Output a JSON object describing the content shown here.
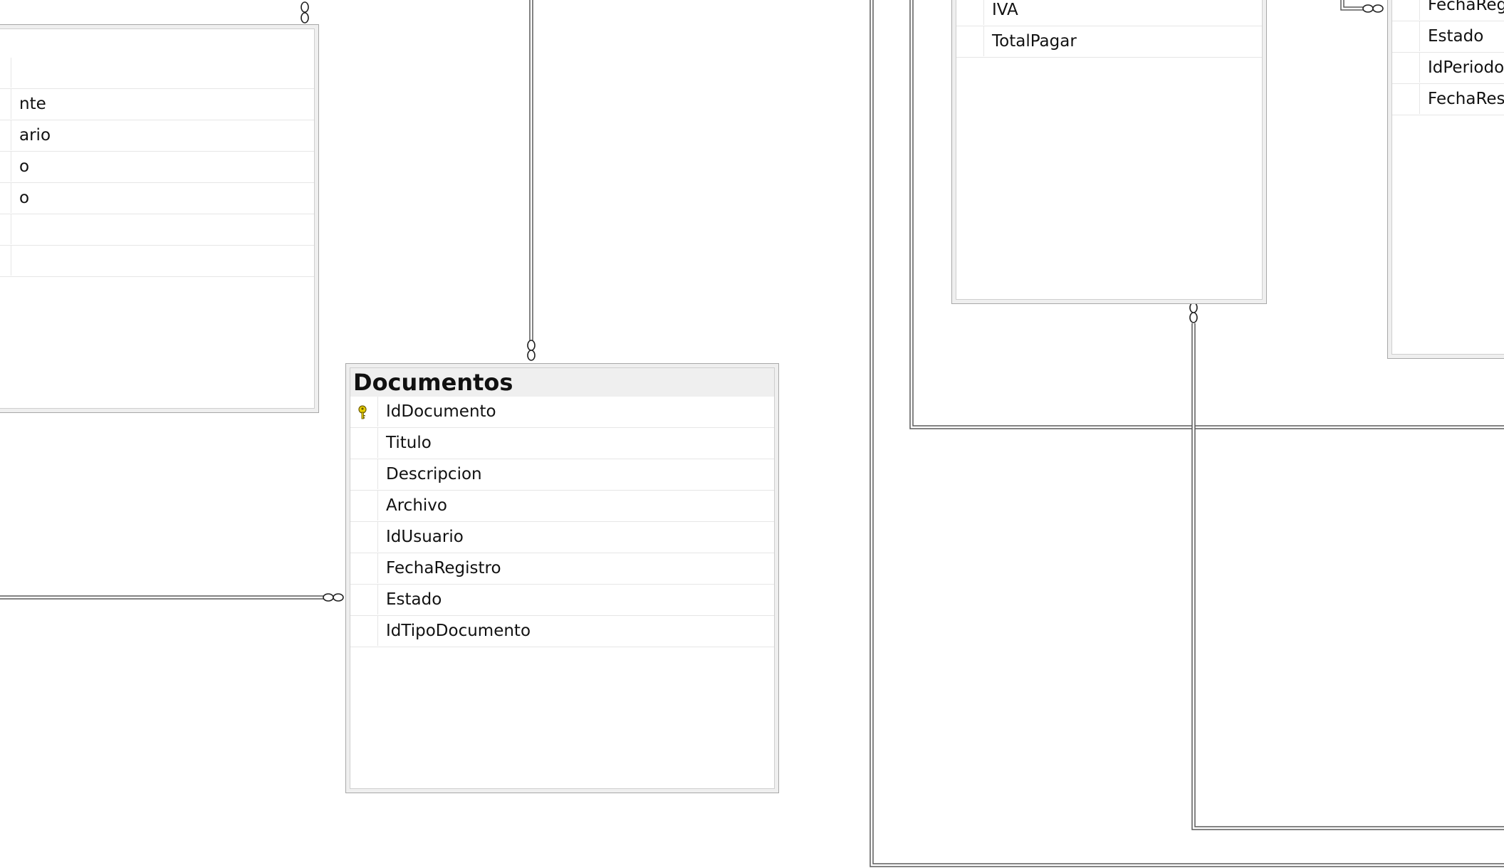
{
  "diagram": {
    "tables": {
      "left": {
        "fields": [
          "",
          "nte",
          "ario",
          "o",
          "o",
          "",
          ""
        ]
      },
      "documentos": {
        "title": "Documentos",
        "fields": [
          {
            "name": "IdDocumento",
            "primary_key": true
          },
          {
            "name": "Titulo"
          },
          {
            "name": "Descripcion"
          },
          {
            "name": "Archivo"
          },
          {
            "name": "IdUsuario"
          },
          {
            "name": "FechaRegistro"
          },
          {
            "name": "Estado"
          },
          {
            "name": "IdTipoDocumento"
          }
        ]
      },
      "middle": {
        "fields": [
          "",
          "IVA",
          "TotalPagar"
        ]
      },
      "right": {
        "fields": [
          "",
          "FechaRegi",
          "Estado",
          "IdPeriodo",
          "FechaResc"
        ]
      }
    },
    "colors": {
      "line": "#5a5a5a",
      "header_bg": "#efefef",
      "key_icon": "#e8d000"
    }
  }
}
